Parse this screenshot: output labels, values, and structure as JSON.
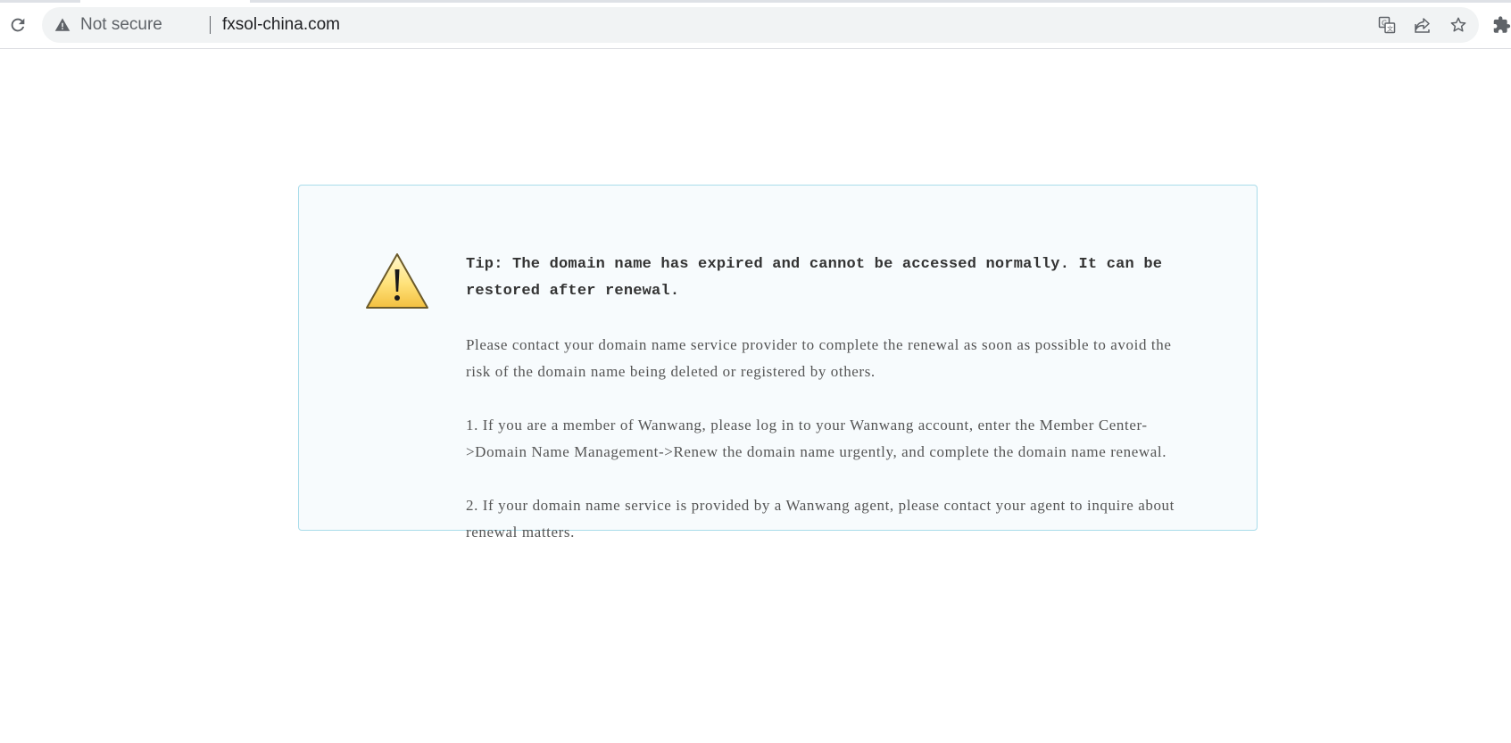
{
  "browser": {
    "security_label": "Not secure",
    "url": "fxsol-china.com",
    "icons": [
      "reload-icon",
      "warning-icon",
      "translate-icon",
      "share-icon",
      "star-icon",
      "extensions-icon"
    ]
  },
  "notice": {
    "icon": "warning-triangle-icon",
    "tip": "Tip: The domain name has expired and cannot be accessed normally. It can be restored after renewal.",
    "paragraphs": [
      "Please contact your domain name service provider to complete the renewal as soon as possible to avoid the risk of the domain name being deleted or registered by others.",
      "1. If you are a member of Wanwang, please log in to your Wanwang account, enter the Member Center->Domain Name Management->Renew the domain name urgently, and complete the domain name renewal.",
      "2. If your domain name service is provided by a Wanwang agent, please contact your agent to inquire about renewal matters."
    ]
  },
  "colors": {
    "box_background": "#f7fbfd",
    "box_border": "#a9dcea",
    "text": "#555555",
    "tip_text": "#333333"
  }
}
